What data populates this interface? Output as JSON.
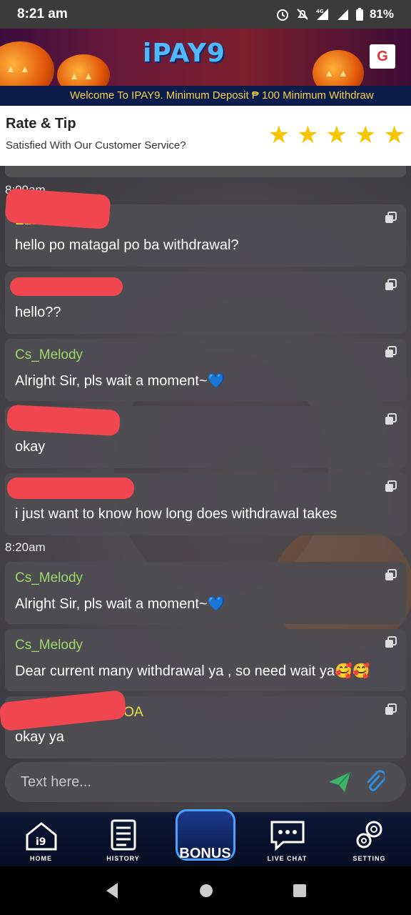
{
  "status_bar": {
    "time": "8:21 am",
    "battery": "81%",
    "icons": [
      "alarm-icon",
      "mute-icon",
      "signal-4g-icon",
      "signal-icon",
      "battery-icon"
    ]
  },
  "banner": {
    "logo_text": "iPAY9",
    "marquee": "Welcome To IPAY9. Minimum Deposit ₱ 100 Minimum Withdraw"
  },
  "rate": {
    "title": "Rate & Tip",
    "subtitle": "Satisfied With Our Customer Service?",
    "stars": 5
  },
  "chat": {
    "groups": [
      {
        "time": "8:09am",
        "messages": [
          {
            "sender": "ELLA ...A",
            "text": "hello po matagal po ba withdrawal?",
            "agent": false,
            "redacted": true
          },
          {
            "sender": "",
            "text": "hello??",
            "agent": false,
            "redacted": true
          },
          {
            "sender": "Cs_Melody",
            "text": "Alright Sir, pls wait a moment~💙",
            "agent": true,
            "redacted": false
          },
          {
            "sender": "ELL... A",
            "text": "okay",
            "agent": false,
            "redacted": true
          },
          {
            "sender": "",
            "text": "i just want to know how long does withdrawal takes",
            "agent": false,
            "redacted": true
          }
        ]
      },
      {
        "time": "8:20am",
        "messages": [
          {
            "sender": "Cs_Melody",
            "text": "Alright Sir, pls wait a moment~💙",
            "agent": true,
            "redacted": false
          },
          {
            "sender": "Cs_Melody",
            "text": "Dear current many withdrawal ya , so need wait ya🥰🥰",
            "agent": true,
            "redacted": false
          },
          {
            "sender": "...EDOA",
            "text": "okay ya",
            "agent": false,
            "redacted": true
          }
        ]
      }
    ]
  },
  "composer": {
    "placeholder": "Text here..."
  },
  "nav": {
    "items": [
      {
        "label": "HOME",
        "icon": "home-icon"
      },
      {
        "label": "HISTORY",
        "icon": "history-icon"
      },
      {
        "label": "BONUS",
        "icon": "gift-icon"
      },
      {
        "label": "LIVE CHAT",
        "icon": "chat-icon"
      },
      {
        "label": "SETTING",
        "icon": "gear-icon"
      }
    ]
  },
  "colors": {
    "agent_name": "#9fd86b",
    "user_name": "#e8e04a",
    "star": "#f7c600",
    "marquee_text": "#f2d34a",
    "send": "#3fb36a",
    "attach": "#2e8fe0"
  }
}
